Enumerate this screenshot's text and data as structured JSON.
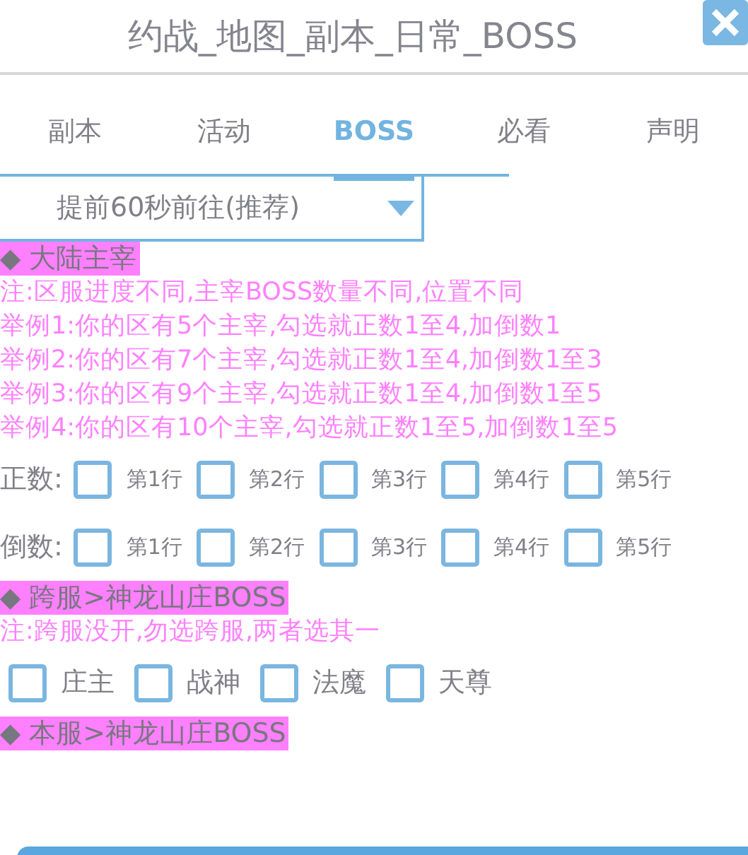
{
  "window": {
    "title": "约战_地图_副本_日常_BOSS"
  },
  "tabs": [
    {
      "label": "副本",
      "selected": false
    },
    {
      "label": "活动",
      "selected": false
    },
    {
      "label": "BOSS",
      "selected": true
    },
    {
      "label": "必看",
      "selected": false
    },
    {
      "label": "声明",
      "selected": false
    }
  ],
  "dropdown": {
    "value": "提前60秒前往(推荐)"
  },
  "sections": [
    {
      "heading": "◆ 大陆主宰",
      "notes": [
        "注:区服进度不同,主宰BOSS数量不同,位置不同",
        "举例1:你的区有5个主宰,勾选就正数1至4,加倒数1",
        "举例2:你的区有7个主宰,勾选就正数1至4,加倒数1至3",
        "举例3:你的区有9个主宰,勾选就正数1至4,加倒数1至5",
        "举例4:你的区有10个主宰,勾选就正数1至5,加倒数1至5"
      ],
      "checkbox_rows": [
        {
          "label": "正数:",
          "items": [
            {
              "label": "第1行",
              "checked": false
            },
            {
              "label": "第2行",
              "checked": false
            },
            {
              "label": "第3行",
              "checked": false
            },
            {
              "label": "第4行",
              "checked": false
            },
            {
              "label": "第5行",
              "checked": false
            }
          ]
        },
        {
          "label": "倒数:",
          "items": [
            {
              "label": "第1行",
              "checked": false
            },
            {
              "label": "第2行",
              "checked": false
            },
            {
              "label": "第3行",
              "checked": false
            },
            {
              "label": "第4行",
              "checked": false
            },
            {
              "label": "第5行",
              "checked": false
            }
          ]
        }
      ]
    },
    {
      "heading": "◆ 跨服>神龙山庄BOSS",
      "notes": [
        "注:跨服没开,勿选跨服,两者选其一"
      ],
      "checkbox_rows": [
        {
          "items": [
            {
              "label": "庄主",
              "checked": false
            },
            {
              "label": "战神",
              "checked": false
            },
            {
              "label": "法魔",
              "checked": false
            },
            {
              "label": "天尊",
              "checked": false
            }
          ]
        }
      ]
    },
    {
      "heading": "◆ 本服>神龙山庄BOSS"
    }
  ]
}
